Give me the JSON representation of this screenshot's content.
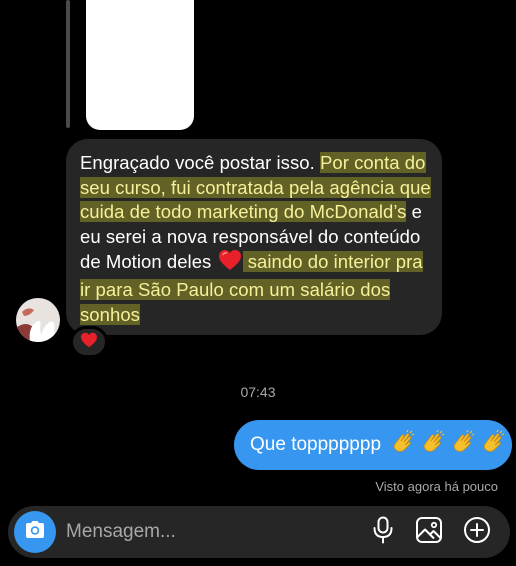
{
  "thread": {
    "shared_post": {
      "icon": "shared-post-thumbnail"
    },
    "incoming_message": {
      "segments": [
        {
          "text": "Engraçado você postar isso. ",
          "highlight": false
        },
        {
          "text": "Por conta do seu curso, fui contratada pela agência que cuida de todo marketing do McDonald’s",
          "highlight": true
        },
        {
          "text": " e eu serei a nova responsável do conteúdo de Motion deles ",
          "highlight": false
        },
        {
          "text": " saindo do interior pra ir para São Paulo com um salário dos sonhos",
          "highlight": true
        }
      ],
      "inline_icon": "red-heart-emoji",
      "reaction": "red-heart-emoji",
      "sender_avatar_icon": "avatar"
    },
    "timestamp": "07:43",
    "outgoing_message": {
      "text": "Que toppppppp",
      "emoji_icon": "clapping-hands-emoji",
      "emoji_count": 4
    },
    "seen_status": "Visto agora há pouco"
  },
  "composer": {
    "placeholder": "Mensagem...",
    "camera_icon": "camera-icon",
    "mic_icon": "microphone-icon",
    "gallery_icon": "gallery-icon",
    "add_icon": "plus-circle-icon"
  },
  "colors": {
    "background": "#000000",
    "incoming_bubble": "#262626",
    "outgoing_bubble": "#3797f0",
    "highlight": "#f3ef28",
    "muted_text": "#a8a8a8",
    "heart": "#e8202a",
    "clap": "#f5c02e"
  }
}
